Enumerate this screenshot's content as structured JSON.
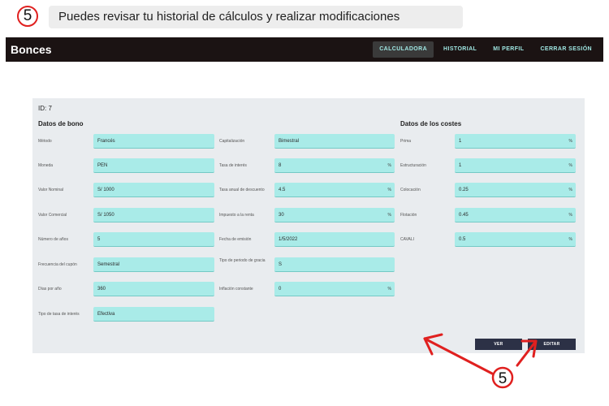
{
  "step": {
    "number": "5",
    "caption": "Puedes revisar tu historial de cálculos y realizar modificaciones"
  },
  "app": {
    "brand": "Bonces"
  },
  "nav": [
    {
      "label": "CALCULADORA",
      "active": true
    },
    {
      "label": "HISTORIAL",
      "active": false
    },
    {
      "label": "MI PERFIL",
      "active": false
    },
    {
      "label": "CERRAR SESIÓN",
      "active": false
    }
  ],
  "card": {
    "id_label": "ID: 7",
    "bono_title": "Datos de bono",
    "costes_title": "Datos de los costes",
    "col1": [
      {
        "label": "Método",
        "value": "Francés",
        "unit": ""
      },
      {
        "label": "Moneda",
        "value": "PEN",
        "unit": ""
      },
      {
        "label": "Valor Nominal",
        "value": "S/ 1000",
        "unit": ""
      },
      {
        "label": "Valor Comercial",
        "value": "S/ 1050",
        "unit": ""
      },
      {
        "label": "Número de años",
        "value": "5",
        "unit": ""
      },
      {
        "label": "Frecuencia del cupón",
        "value": "Semestral",
        "unit": ""
      },
      {
        "label": "Días por año",
        "value": "360",
        "unit": ""
      },
      {
        "label": "Tipo de tasa de interés",
        "value": "Efectiva",
        "unit": ""
      }
    ],
    "col2": [
      {
        "label": "Capitalización",
        "value": "Bimestral",
        "unit": ""
      },
      {
        "label": "Tasa de interés",
        "value": "8",
        "unit": "%"
      },
      {
        "label": "Tasa anual de descuento",
        "value": "4.5",
        "unit": "%"
      },
      {
        "label": "Impuesto a la renta",
        "value": "30",
        "unit": "%"
      },
      {
        "label": "Fecha de emisión",
        "value": "1/5/2022",
        "unit": ""
      },
      {
        "label": "Tipo de periodo de gracia",
        "value": "S",
        "unit": ""
      },
      {
        "label": "Inflación constante",
        "value": "0",
        "unit": "%"
      }
    ],
    "col3": [
      {
        "label": "Prima",
        "value": "1",
        "unit": "%"
      },
      {
        "label": "Estructuración",
        "value": "1",
        "unit": "%"
      },
      {
        "label": "Colocación",
        "value": "0.25",
        "unit": "%"
      },
      {
        "label": "Flotación",
        "value": "0.45",
        "unit": "%"
      },
      {
        "label": "CAVALI",
        "value": "0.5",
        "unit": "%"
      }
    ],
    "buttons": {
      "ver": "VER",
      "editar": "EDITAR"
    }
  },
  "annotation": {
    "number": "5",
    "color": "#e0201f"
  }
}
